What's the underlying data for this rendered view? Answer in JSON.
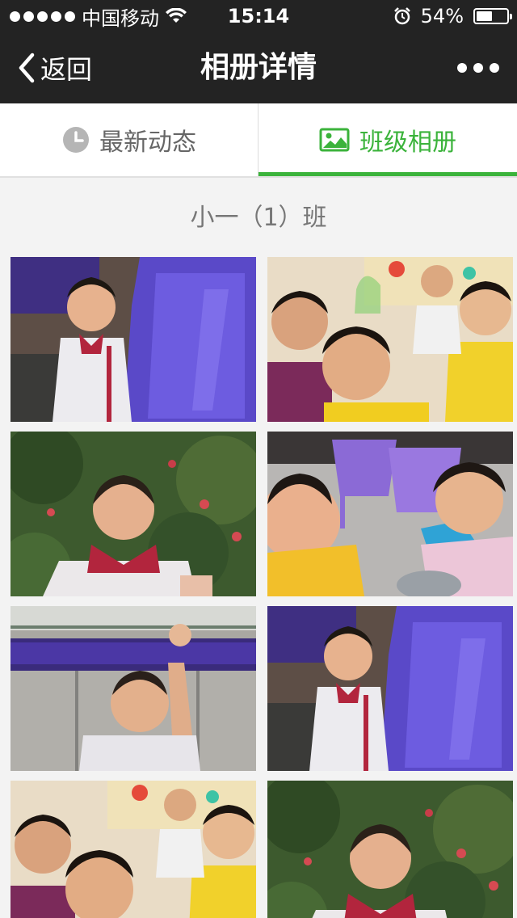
{
  "status": {
    "carrier": "中国移动",
    "time": "15:14",
    "battery": "54%",
    "battery_level": 0.54
  },
  "nav": {
    "back_label": "返回",
    "title": "相册详情"
  },
  "tabs": [
    {
      "label": "最新动态",
      "active": false
    },
    {
      "label": "班级相册",
      "active": true
    }
  ],
  "album": {
    "title": "小一（1）班",
    "photos": [
      {
        "subject": "boy-on-purple-slide"
      },
      {
        "subject": "group-of-children-indoors"
      },
      {
        "subject": "boy-in-front-of-bushes"
      },
      {
        "subject": "children-with-bowl-indoors"
      },
      {
        "subject": "boy-on-swing"
      },
      {
        "subject": "boy-on-purple-slide"
      },
      {
        "subject": "group-of-children-indoors"
      },
      {
        "subject": "boy-in-front-of-bushes"
      }
    ]
  },
  "colors": {
    "accent": "#3bb33b",
    "bar_bg": "#232323",
    "page_bg": "#f3f3f3"
  }
}
